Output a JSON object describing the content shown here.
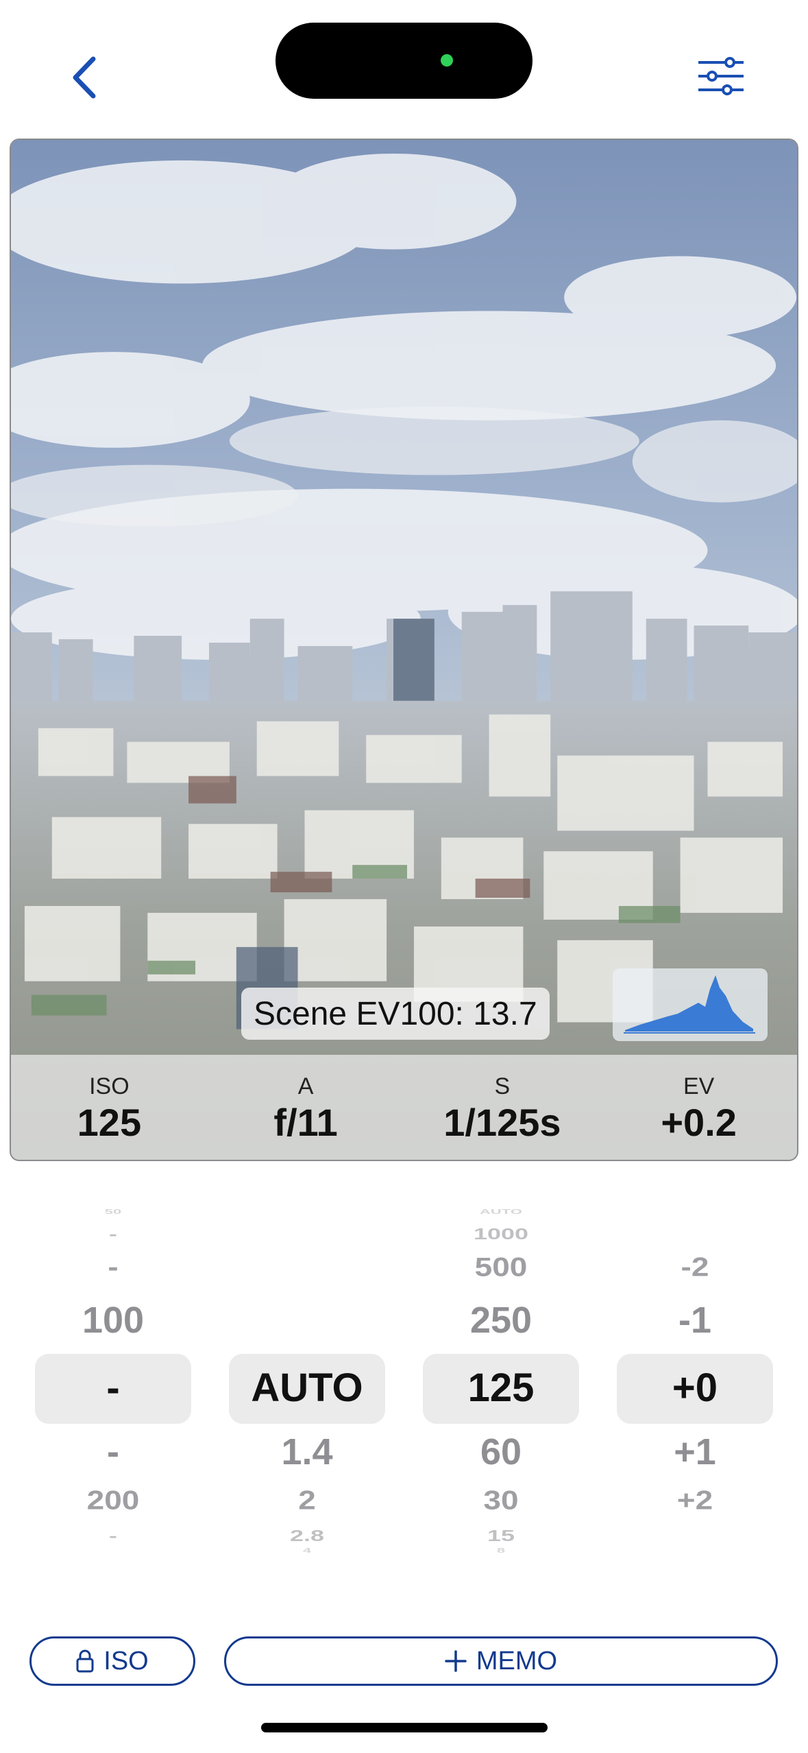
{
  "scene": {
    "ev_label": "Scene EV100: 13.7"
  },
  "readout": [
    {
      "label": "ISO",
      "value": "125"
    },
    {
      "label": "A",
      "value": "f/11"
    },
    {
      "label": "S",
      "value": "1/125s"
    },
    {
      "label": "EV",
      "value": "+0.2"
    }
  ],
  "wheels": {
    "iso": [
      "50",
      "-",
      "-",
      "100",
      "-",
      "-",
      "200",
      "-",
      ""
    ],
    "aperture": [
      "",
      "",
      "",
      "",
      "AUTO",
      "1.4",
      "2",
      "2.8",
      "4"
    ],
    "shutter": [
      "AUTO",
      "1000",
      "500",
      "250",
      "125",
      "60",
      "30",
      "15",
      "8"
    ],
    "ev": [
      "",
      "",
      "-2",
      "-1",
      "+0",
      "+1",
      "+2",
      "",
      ""
    ]
  },
  "buttons": {
    "iso_lock_label": "ISO",
    "memo_label": "MEMO"
  },
  "colors": {
    "accent": "#123a8e",
    "back_icon": "#1a4fb3",
    "histogram": "#3a7bd5",
    "island_dot": "#2fd158"
  },
  "icons": {
    "back": "chevron-left-icon",
    "settings": "sliders-icon",
    "lock": "lock-icon",
    "add": "plus-icon"
  }
}
